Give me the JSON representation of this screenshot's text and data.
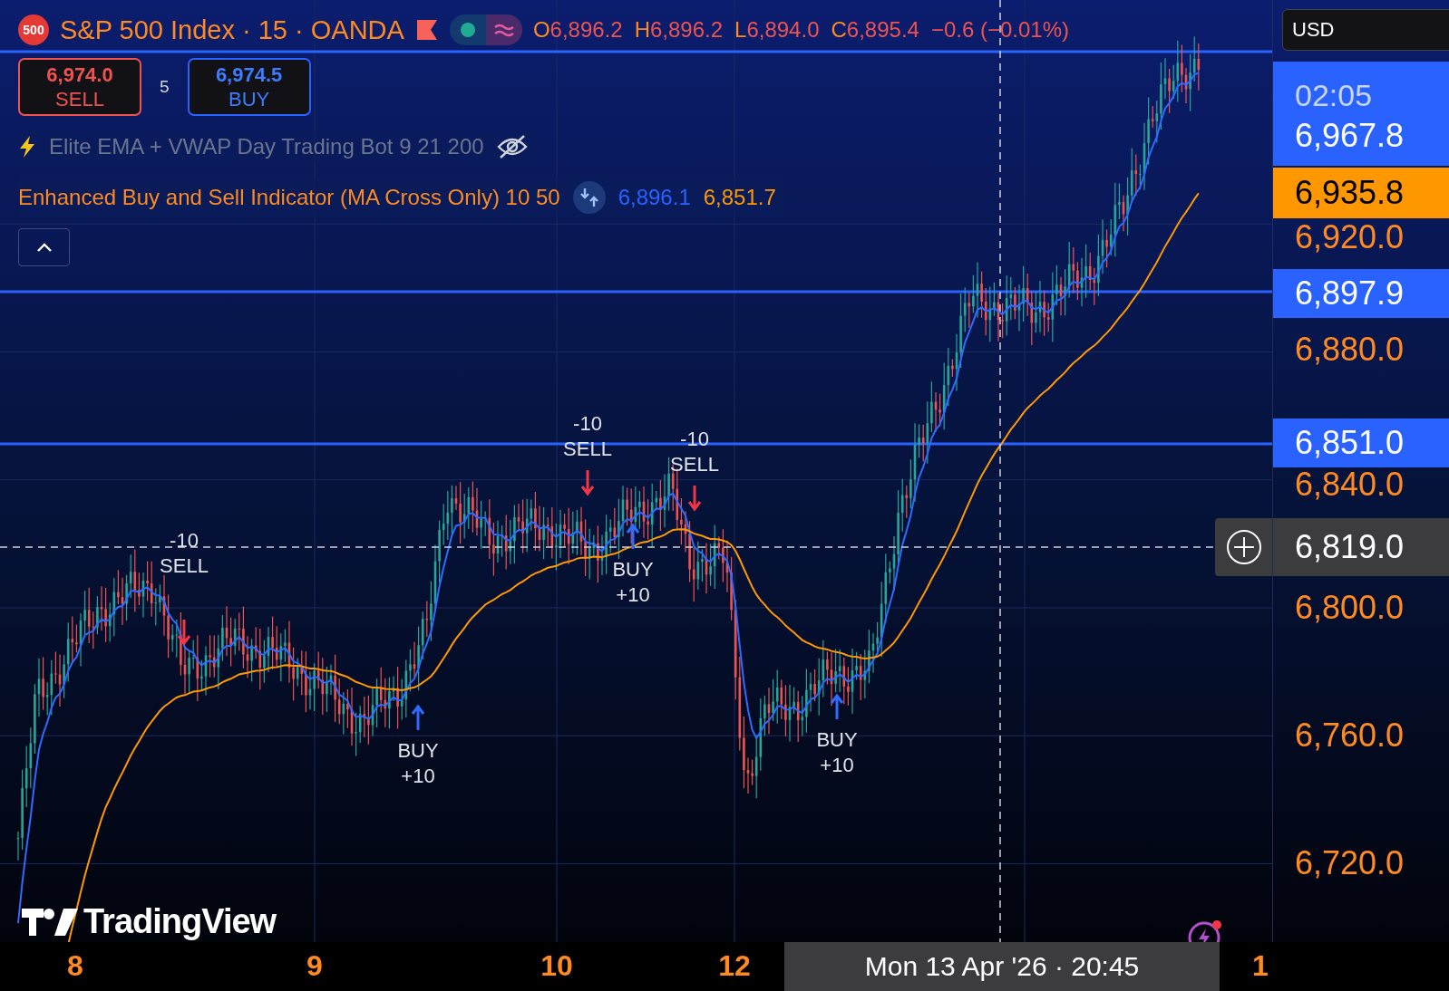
{
  "header": {
    "symbol_badge": "500",
    "title": "S&P 500 Index · 15 · OANDA",
    "ohlc": [
      {
        "label": "O",
        "value": "6,896.2"
      },
      {
        "label": "H",
        "value": "6,896.2"
      },
      {
        "label": "L",
        "value": "6,894.0"
      },
      {
        "label": "C",
        "value": "6,895.4"
      }
    ],
    "change": "−0.6 (−0.01%)"
  },
  "trade": {
    "sell_price": "6,974.0",
    "sell_label": "SELL",
    "spread": "5",
    "buy_price": "6,974.5",
    "buy_label": "BUY"
  },
  "indicators": [
    {
      "name": "Elite EMA + VWAP Day Trading Bot 9 21 200",
      "hidden": true
    },
    {
      "name": "Enhanced Buy and Sell Indicator (MA Cross Only) 10 50",
      "hidden": false,
      "values": [
        {
          "text": "6,896.1",
          "color": "#2962ff"
        },
        {
          "text": "6,851.7",
          "color": "#ff9800"
        }
      ]
    }
  ],
  "signals": [
    {
      "kind": "sell",
      "amount": "-10",
      "label": "SELL"
    },
    {
      "kind": "sell",
      "amount": "-10",
      "label": "SELL"
    },
    {
      "kind": "sell",
      "amount": "-10",
      "label": "SELL"
    },
    {
      "kind": "buy",
      "amount": "+10",
      "label": "BUY"
    },
    {
      "kind": "buy",
      "amount": "+10",
      "label": "BUY"
    },
    {
      "kind": "buy",
      "amount": "+10",
      "label": "BUY"
    }
  ],
  "logo": "TradingView",
  "currency": "USD",
  "price_labels": [
    {
      "kind": "last",
      "text": "6,967.8",
      "countdown": "02:05"
    },
    {
      "kind": "ma",
      "text": "6,935.8"
    },
    {
      "kind": "line",
      "text": "6,897.9"
    },
    {
      "kind": "line",
      "text": "6,851.0"
    },
    {
      "kind": "crosshair",
      "text": "6,819.0"
    }
  ],
  "price_axis": [
    "6,920.0",
    "6,880.0",
    "6,840.0",
    "6,800.0",
    "6,760.0",
    "6,720.0"
  ],
  "time_axis": [
    "8",
    "9",
    "10",
    "12",
    "1"
  ],
  "crosshair_time": "Mon 13 Apr '26 · 20:45"
}
